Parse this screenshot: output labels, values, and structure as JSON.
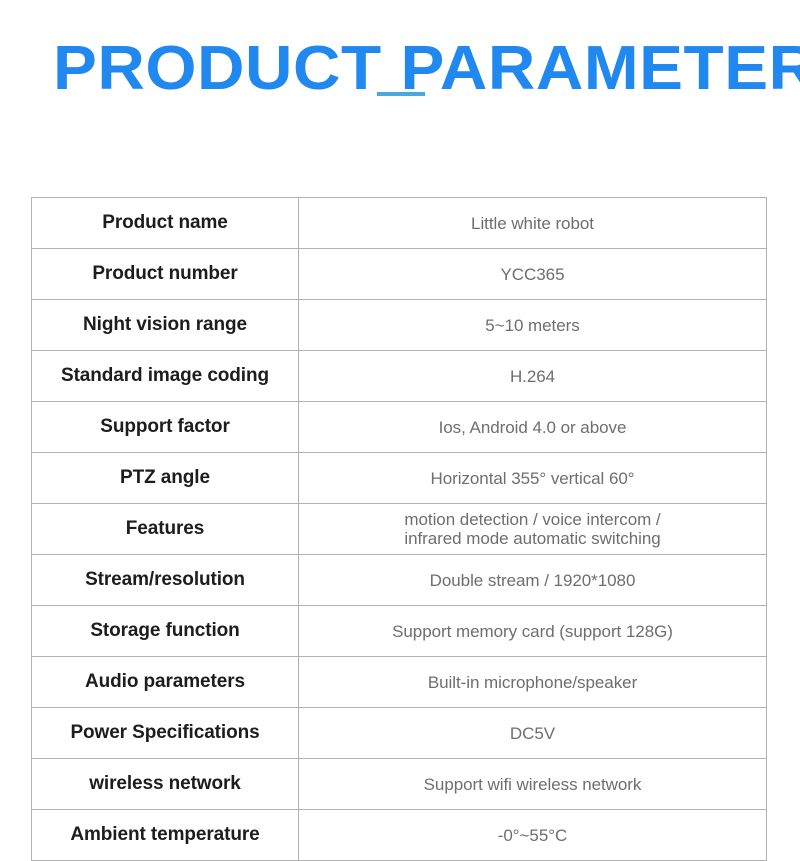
{
  "header": {
    "title": "PRODUCT PARAMETERS",
    "accent_color": "#4ba8dc",
    "title_color": "#2088ef"
  },
  "table": {
    "border_color": "#b2b2b2",
    "label_color": "#1d1d1d",
    "value_color": "#6e6e6e",
    "rows": [
      {
        "label": "Product name",
        "value": "Little white robot"
      },
      {
        "label": "Product number",
        "value": "YCC365"
      },
      {
        "label": "Night vision range",
        "value": "5~10 meters"
      },
      {
        "label": "Standard image coding",
        "value": "H.264"
      },
      {
        "label": "Support factor",
        "value": "Ios, Android 4.0 or above"
      },
      {
        "label": "PTZ angle",
        "value": "Horizontal 355° vertical 60°"
      },
      {
        "label": "Features",
        "value": "motion detection / voice intercom /",
        "value2": "infrared mode automatic switching"
      },
      {
        "label": "Stream/resolution",
        "value": "Double stream / 1920*1080"
      },
      {
        "label": "Storage function",
        "value": "Support memory card (support 128G)"
      },
      {
        "label": "Audio parameters",
        "value": "Built-in microphone/speaker"
      },
      {
        "label": "Power Specifications",
        "value": "DC5V"
      },
      {
        "label": "wireless network",
        "value": "Support wifi wireless network"
      },
      {
        "label": "Ambient temperature",
        "value": "-0°~55°C"
      }
    ]
  }
}
